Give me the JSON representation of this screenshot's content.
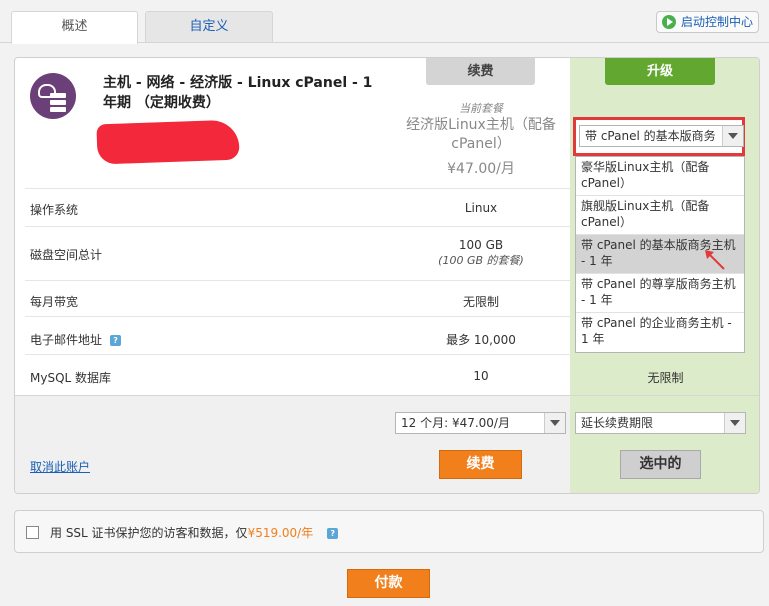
{
  "tabs": {
    "overview": "概述",
    "custom": "自定义"
  },
  "header": {
    "launch_control": "启动控制中心"
  },
  "product": {
    "title": "主机 - 网络 - 经济版 - Linux cPanel - 1 年期 （定期收费）",
    "icon": "cloud-server-icon",
    "icon_color": "#6b3f78"
  },
  "columns": {
    "renew": "续费",
    "upgrade": "升级"
  },
  "current_plan": {
    "label": "当前套餐",
    "name": "经济版Linux主机（配备 cPanel）",
    "price": "¥47.00/月"
  },
  "rows": [
    {
      "label": "操作系统",
      "value": "Linux",
      "sub": "",
      "upgrade": ""
    },
    {
      "label": "磁盘空间总计",
      "value": "100 GB",
      "sub": "(100 GB 的套餐)",
      "upgrade": ""
    },
    {
      "label": "每月带宽",
      "value": "无限制",
      "sub": "",
      "upgrade": ""
    },
    {
      "label": "电子邮件地址",
      "value": "最多 10,000",
      "sub": "",
      "upgrade": ""
    },
    {
      "label": "MySQL 数据库",
      "value": "10",
      "sub": "",
      "upgrade": "无限制"
    }
  ],
  "renew_select": {
    "value": "12 个月: ¥47.00/月"
  },
  "extend_select": {
    "value": "延长续费期限"
  },
  "buttons": {
    "renew": "续费",
    "selected": "选中的",
    "cancel_account": "取消此账户",
    "pay": "付款"
  },
  "upgrade_dropdown": {
    "selected": "带 cPanel 的基本版商务",
    "options": [
      "豪华版Linux主机（配备 cPanel）",
      "旗舰版Linux主机（配备 cPanel）",
      "带 cPanel 的基本版商务主机 - 1 年",
      "带 cPanel 的尊享版商务主机 - 1 年",
      "带 cPanel 的企业商务主机 - 1 年"
    ],
    "highlighted_index": 2
  },
  "ssl": {
    "text": "用 SSL 证书保护您的访客和数据，仅",
    "price": "¥519.00/年"
  },
  "colors": {
    "accent_orange": "#f07f1c",
    "upgrade_green": "#62a830",
    "upgrade_bg": "#dcebc9",
    "link_blue": "#1a5fb4",
    "highlight_red": "#e23a3a"
  }
}
